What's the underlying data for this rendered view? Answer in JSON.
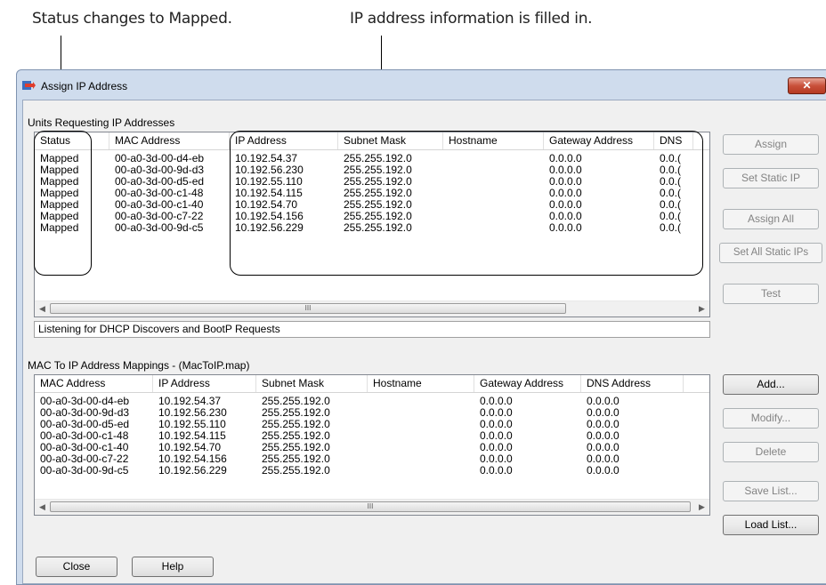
{
  "callouts": {
    "status_note": "Status changes to Mapped.",
    "ip_note": "IP address information is filled in."
  },
  "window": {
    "title": "Assign IP Address",
    "close_label": "✕"
  },
  "requests": {
    "group_label": "Units Requesting IP Addresses",
    "columns": [
      "Status",
      "MAC Address",
      "IP Address",
      "Subnet Mask",
      "Hostname",
      "Gateway Address",
      "DNS"
    ],
    "rows": [
      [
        "Mapped",
        "00-a0-3d-00-d4-eb",
        "10.192.54.37",
        "255.255.192.0",
        "",
        "0.0.0.0",
        "0.0.("
      ],
      [
        "Mapped",
        "00-a0-3d-00-9d-d3",
        "10.192.56.230",
        "255.255.192.0",
        "",
        "0.0.0.0",
        "0.0.("
      ],
      [
        "Mapped",
        "00-a0-3d-00-d5-ed",
        "10.192.55.110",
        "255.255.192.0",
        "",
        "0.0.0.0",
        "0.0.("
      ],
      [
        "Mapped",
        "00-a0-3d-00-c1-48",
        "10.192.54.115",
        "255.255.192.0",
        "",
        "0.0.0.0",
        "0.0.("
      ],
      [
        "Mapped",
        "00-a0-3d-00-c1-40",
        "10.192.54.70",
        "255.255.192.0",
        "",
        "0.0.0.0",
        "0.0.("
      ],
      [
        "Mapped",
        "00-a0-3d-00-c7-22",
        "10.192.54.156",
        "255.255.192.0",
        "",
        "0.0.0.0",
        "0.0.("
      ],
      [
        "Mapped",
        "00-a0-3d-00-9d-c5",
        "10.192.56.229",
        "255.255.192.0",
        "",
        "0.0.0.0",
        "0.0.("
      ]
    ],
    "scroll_grip": "III"
  },
  "status_text": "Listening for DHCP Discovers and BootP Requests",
  "mappings": {
    "group_label": "MAC To IP Address Mappings - (MacToIP.map)",
    "columns": [
      "MAC Address",
      "IP Address",
      "Subnet Mask",
      "Hostname",
      "Gateway Address",
      "DNS Address"
    ],
    "rows": [
      [
        "00-a0-3d-00-d4-eb",
        "10.192.54.37",
        "255.255.192.0",
        "",
        "0.0.0.0",
        "0.0.0.0"
      ],
      [
        "00-a0-3d-00-9d-d3",
        "10.192.56.230",
        "255.255.192.0",
        "",
        "0.0.0.0",
        "0.0.0.0"
      ],
      [
        "00-a0-3d-00-d5-ed",
        "10.192.55.110",
        "255.255.192.0",
        "",
        "0.0.0.0",
        "0.0.0.0"
      ],
      [
        "00-a0-3d-00-c1-48",
        "10.192.54.115",
        "255.255.192.0",
        "",
        "0.0.0.0",
        "0.0.0.0"
      ],
      [
        "00-a0-3d-00-c1-40",
        "10.192.54.70",
        "255.255.192.0",
        "",
        "0.0.0.0",
        "0.0.0.0"
      ],
      [
        "00-a0-3d-00-c7-22",
        "10.192.54.156",
        "255.255.192.0",
        "",
        "0.0.0.0",
        "0.0.0.0"
      ],
      [
        "00-a0-3d-00-9d-c5",
        "10.192.56.229",
        "255.255.192.0",
        "",
        "0.0.0.0",
        "0.0.0.0"
      ]
    ],
    "scroll_grip": "III"
  },
  "buttons": {
    "assign": "Assign",
    "set_static_ip": "Set Static IP",
    "assign_all": "Assign All",
    "set_all_static": "Set All Static IPs",
    "test": "Test",
    "add": "Add...",
    "modify": "Modify...",
    "delete": "Delete",
    "save_list": "Save List...",
    "load_list": "Load List...",
    "close": "Close",
    "help": "Help"
  },
  "colors": {
    "window_frame": "#cfdced",
    "close_button": "#c9503a",
    "dialog_bg": "#f0f0f0"
  }
}
